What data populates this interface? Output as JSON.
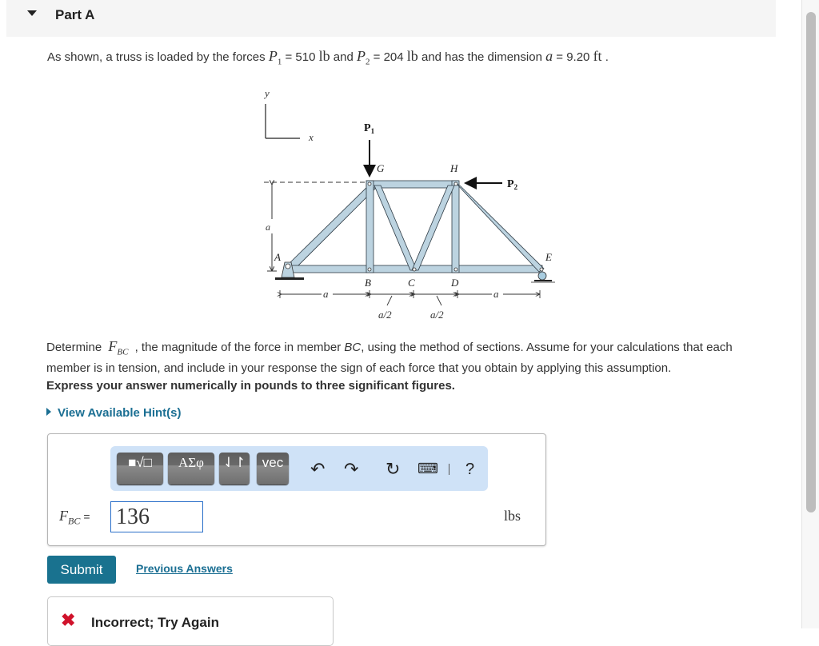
{
  "part": {
    "title": "Part A",
    "toggle_icon": "caret-down-icon"
  },
  "problem": {
    "intro": "As shown, a truss is loaded by the forces ",
    "p1_sym": "P",
    "p1_sub": "1",
    "p1_eq": " = 510 ",
    "p1_unit": "lb",
    "and1": " and ",
    "p2_sym": "P",
    "p2_sub": "2",
    "p2_eq": " = 204 ",
    "p2_unit": "lb",
    "and2": " and has the dimension ",
    "a_sym": "a",
    "a_eq": " = 9.20 ",
    "a_unit": "ft",
    "end": " ."
  },
  "figure": {
    "axis_y": "y",
    "axis_x": "x",
    "force1": "P",
    "force1_sub": "1",
    "force2": "P",
    "force2_sub": "2",
    "nodes": {
      "A": "A",
      "B": "B",
      "C": "C",
      "D": "D",
      "E": "E",
      "G": "G",
      "H": "H"
    },
    "dim_a": "a",
    "dim_half": "a/2"
  },
  "question": {
    "pre": "Determine ",
    "sym": "F",
    "sub": "BC",
    "post_1": " , the magnitude of the force in member ",
    "member": "BC",
    "post_2": ", using the method of sections. Assume for your calculations that each member is in tension, and include in your response the sign of each force that you obtain by applying this assumption."
  },
  "instruction": "Express your answer numerically in pounds to three significant figures.",
  "hints_label": "View Available Hint(s)",
  "toolbar": {
    "template_btn": "■√□",
    "greek_btn": "ΑΣφ",
    "arrows_btn": "⇃↾",
    "vec_btn": "vec",
    "undo_icon": "undo-icon",
    "redo_icon": "redo-icon",
    "reset_icon": "reset-icon",
    "keyboard_icon": "keyboard-icon",
    "help": "?"
  },
  "answer": {
    "label_sym": "F",
    "label_sub": "BC",
    "label_eq": "=",
    "value": "136",
    "units": "lbs"
  },
  "submit_label": "Submit",
  "previous_answers_label": "Previous Answers",
  "feedback": {
    "icon": "✖",
    "message": "Incorrect; Try Again"
  }
}
